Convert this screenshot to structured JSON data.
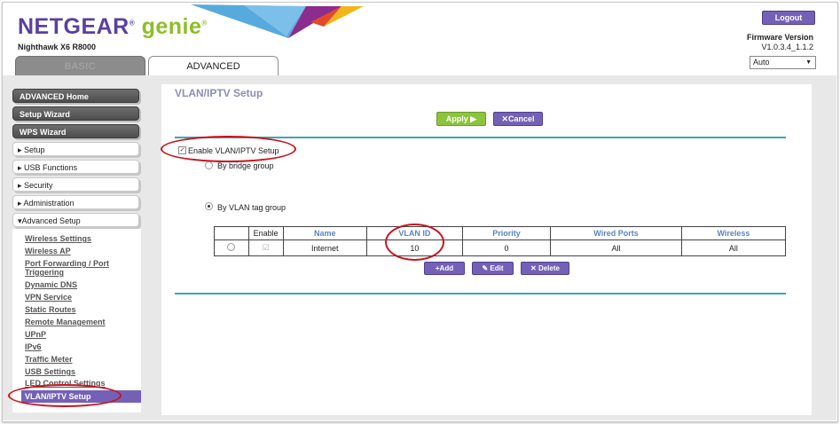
{
  "header": {
    "brand_main": "NETGEAR",
    "brand_reg": "®",
    "brand_genie": "genie",
    "brand_tm": "®",
    "model": "Nighthawk X6 R8000",
    "logout_label": "Logout",
    "firmware_label": "Firmware Version",
    "firmware_value": "V1.0.3.4_1.1.2",
    "language_value": "Auto"
  },
  "tabs": [
    {
      "label": "BASIC",
      "active": false
    },
    {
      "label": "ADVANCED",
      "active": true
    }
  ],
  "nav": {
    "primary": [
      "ADVANCED Home",
      "Setup Wizard",
      "WPS Wizard"
    ],
    "sections": [
      "Setup",
      "USB Functions",
      "Security",
      "Administration",
      "Advanced Setup"
    ],
    "sub_items": [
      "Wireless Settings",
      "Wireless AP",
      "Port Forwarding / Port",
      "Triggering",
      "Dynamic DNS",
      "VPN Service",
      "Static Routes",
      "Remote Management",
      "UPnP",
      "IPv6",
      "Traffic Meter",
      "USB Settings",
      "LED Control Settings"
    ],
    "active_item": "VLAN/IPTV Setup"
  },
  "main": {
    "title": "VLAN/IPTV Setup",
    "apply_label": "Apply ▶",
    "cancel_label": "Cancel",
    "enable_label": "Enable VLAN/IPTV Setup",
    "enable_checked": true,
    "bridge_label": "By bridge group",
    "tag_label": "By VLAN tag group",
    "selected_mode": "tag"
  },
  "vlan_table": {
    "headers": [
      "",
      "Enable",
      "Name",
      "VLAN ID",
      "Priority",
      "Wired Ports",
      "Wireless"
    ],
    "rows": [
      {
        "enable": true,
        "name": "Internet",
        "vlan_id": "10",
        "priority": "0",
        "wired_ports": "All",
        "wireless": "All"
      }
    ],
    "add_label": "Add",
    "edit_label": "Edit",
    "delete_label": "Delete"
  },
  "colors": {
    "brand_purple": "#5b3fa0",
    "brand_green": "#8cbf26",
    "button_purple": "#7461b7",
    "apply_green": "#8cc43d",
    "rule_teal": "#3aa6b9",
    "highlight_red": "#c8141e"
  }
}
